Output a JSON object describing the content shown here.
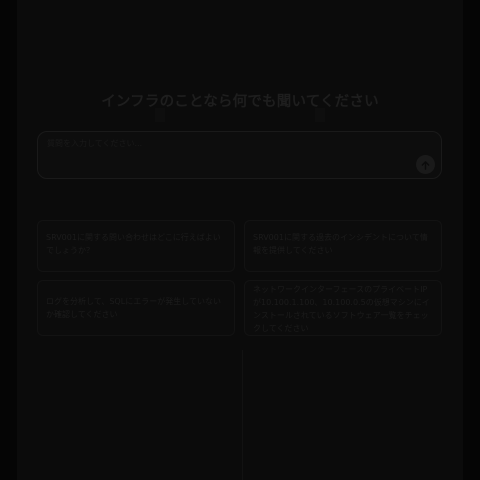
{
  "main": {
    "heading": "インフラのことなら何でも聞いてください"
  },
  "input": {
    "placeholder": "質問を入力してください..."
  },
  "icons": {
    "send": "send-arrow-icon"
  },
  "suggestions": [
    {
      "text": "SRV001に関する問い合わせはどこに行えばよいでしょうか？"
    },
    {
      "text": "SRV001に関する過去のインシデントについて情報を提供してください"
    },
    {
      "text": "ログを分析して、SQLにエラーが発生していないか確認してください"
    },
    {
      "text": "ネットワークインターフェースのプライベートIPが10.100.1.100、10.100.0.5の仮想マシンにインストールされているソフトウェア一覧をチェックしてください"
    }
  ]
}
